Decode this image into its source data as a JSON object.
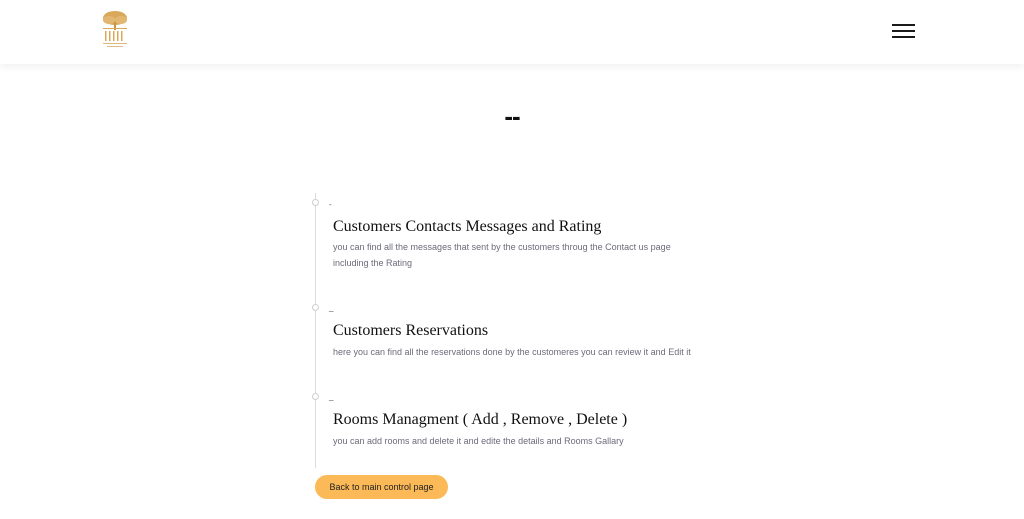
{
  "header": {
    "logo_icon": "tree-logo",
    "menu_icon": "hamburger-menu-icon"
  },
  "page": {
    "title": "--"
  },
  "timeline": {
    "items": [
      {
        "date": "-",
        "title": "Customers Contacts Messages and Rating",
        "description": "you can find all the messages that sent by the customers throug the Contact us page including the Rating"
      },
      {
        "date": "_",
        "title": "Customers Reservations",
        "description": "here you can find all the reservations done by the customeres you can review it and Edit it"
      },
      {
        "date": "_",
        "title": "Rooms Managment ( Add , Remove , Delete )",
        "description": "you can add rooms and delete it and edite the details and Rooms Gallary"
      }
    ]
  },
  "actions": {
    "back_label": "Back to main control page"
  },
  "colors": {
    "accent": "#fbb958",
    "logo": "#d9a85a"
  }
}
